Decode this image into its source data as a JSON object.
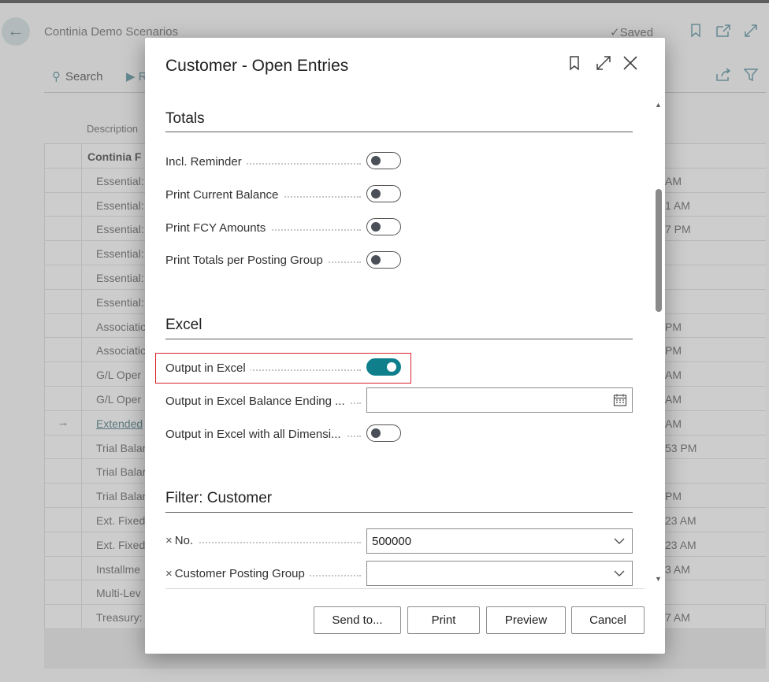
{
  "background": {
    "title": "Continia Demo Scenarios",
    "saved_label": "Saved",
    "toolbar": {
      "search_label": "Search",
      "run_label": "R"
    },
    "column_header": "Description",
    "rows": [
      {
        "text": "Continia F",
        "right": "",
        "type": "group",
        "gutter": ""
      },
      {
        "text": "Essential:",
        "right": "AM",
        "type": "item",
        "gutter": ""
      },
      {
        "text": "Essential:",
        "right": "1 AM",
        "type": "item",
        "gutter": ""
      },
      {
        "text": "Essential:",
        "right": "7 PM",
        "type": "item",
        "gutter": ""
      },
      {
        "text": "Essential:",
        "right": "",
        "type": "item",
        "gutter": ""
      },
      {
        "text": "Essential:",
        "right": "",
        "type": "item",
        "gutter": ""
      },
      {
        "text": "Essential:",
        "right": "",
        "type": "item",
        "gutter": ""
      },
      {
        "text": "Associatio",
        "right": "PM",
        "type": "item",
        "gutter": ""
      },
      {
        "text": "Associatio",
        "right": "PM",
        "type": "item",
        "gutter": ""
      },
      {
        "text": "G/L Oper",
        "right": "AM",
        "type": "item",
        "gutter": ""
      },
      {
        "text": "G/L Oper",
        "right": "AM",
        "type": "item",
        "gutter": ""
      },
      {
        "text": "Extended",
        "right": "AM",
        "type": "link",
        "gutter": "→"
      },
      {
        "text": "Trial Balar",
        "right": "53 PM",
        "type": "item",
        "gutter": ""
      },
      {
        "text": "Trial Balar",
        "right": "",
        "type": "item",
        "gutter": ""
      },
      {
        "text": "Trial Balar",
        "right": "PM",
        "type": "item",
        "gutter": ""
      },
      {
        "text": "Ext. Fixed",
        "right": "23 AM",
        "type": "item",
        "gutter": ""
      },
      {
        "text": "Ext. Fixed",
        "right": "23 AM",
        "type": "item",
        "gutter": ""
      },
      {
        "text": "Installme",
        "right": "3 AM",
        "type": "item",
        "gutter": ""
      },
      {
        "text": "Multi-Lev",
        "right": "",
        "type": "item",
        "gutter": ""
      },
      {
        "text": "Treasury:",
        "right": "7 AM",
        "type": "item",
        "gutter": ""
      }
    ]
  },
  "dialog": {
    "title": "Customer - Open Entries",
    "sections": {
      "totals": {
        "title": "Totals",
        "fields": [
          {
            "label": "Incl. Reminder",
            "on": false
          },
          {
            "label": "Print Current Balance",
            "on": false
          },
          {
            "label": "Print FCY Amounts",
            "on": false
          },
          {
            "label": "Print Totals per Posting Group",
            "on": false
          }
        ]
      },
      "excel": {
        "title": "Excel",
        "output_in_excel_label": "Output in Excel",
        "output_in_excel_on": true,
        "balance_ending_label": "Output in Excel Balance Ending ...",
        "balance_ending_value": "",
        "all_dimensions_label": "Output in Excel with all Dimensi...",
        "all_dimensions_on": false
      },
      "filter": {
        "title": "Filter: Customer",
        "no_label": "No.",
        "no_value": "500000",
        "posting_group_label": "Customer Posting Group",
        "posting_group_value": ""
      }
    },
    "buttons": {
      "send_to": "Send to...",
      "print": "Print",
      "preview": "Preview",
      "cancel": "Cancel"
    }
  },
  "colors": {
    "accent": "#0f7f8c",
    "highlight_box": "#d8232a"
  }
}
